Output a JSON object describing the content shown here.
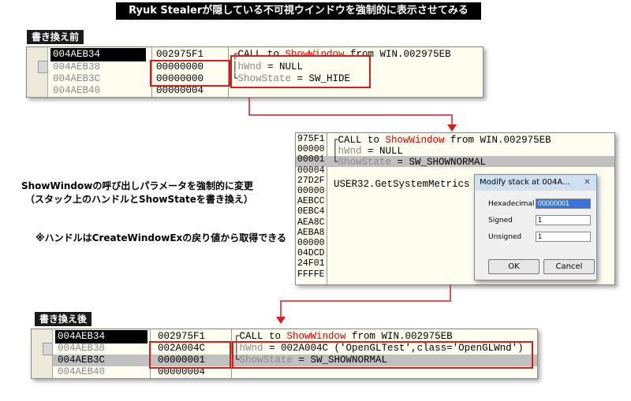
{
  "title": "Ryuk Stealerが隠している不可視ウインドウを強制的に表示させてみる",
  "before": {
    "label": "書き換え前",
    "rows": [
      {
        "addr": "004AEB34",
        "value": "002975F1",
        "comment_pre": "CALL to ",
        "comment_fn": "ShowWindow",
        "comment_post": " from WIN.002975EB"
      },
      {
        "addr": "004AEB38",
        "value": "00000000",
        "comment": "hWnd = NULL"
      },
      {
        "addr": "004AEB3C",
        "value": "00000000",
        "comment": "ShowState = SW_HIDE"
      },
      {
        "addr": "004AEB40",
        "value": "00000004",
        "comment": ""
      }
    ]
  },
  "middle": {
    "left_col": [
      "975F1",
      "00000",
      "00001",
      "00004",
      "27D2F",
      "00000",
      "AEBCC",
      "0EBC4",
      "AEA8C",
      "AEBA8",
      "00000",
      "04DCD",
      "24F01",
      "FFFFE"
    ],
    "line1_pre": "CALL to ",
    "line1_fn": "ShowWindow",
    "line1_post": " from WIN.002975EB",
    "line2": "hWnd = NULL",
    "line3": "ShowState = SW_SHOWNORMAL",
    "line5": "USER32.GetSystemMetrics"
  },
  "annotation": {
    "line1": "ShowWindowの呼び出しパラメータを強制的に変更",
    "line2": "（スタック上のハンドルとShowStateを書き換え）",
    "line3": "※ハンドルはCreateWindowExの戻り値から取得できる"
  },
  "dialog": {
    "title": "Modify stack at 004A...",
    "close": "✕",
    "fields": [
      {
        "label": "Hexadecimal",
        "value": "00000001"
      },
      {
        "label": "Signed",
        "value": "1"
      },
      {
        "label": "Unsigned",
        "value": "1"
      }
    ],
    "ok": "OK",
    "cancel": "Cancel"
  },
  "after": {
    "label": "書き換え後",
    "rows": [
      {
        "addr": "004AEB34",
        "value": "002975F1",
        "comment_pre": "CALL to ",
        "comment_fn": "ShowWindow",
        "comment_post": " from WIN.002975EB"
      },
      {
        "addr": "004AEB38",
        "value": "002A004C",
        "comment": "hWnd = 002A004C ('OpenGLTest',class='OpenGLWnd')"
      },
      {
        "addr": "004AEB3C",
        "value": "00000001",
        "comment": "ShowState = SW_SHOWNORMAL"
      },
      {
        "addr": "004AEB40",
        "value": "00000004",
        "comment": ""
      }
    ]
  },
  "colors": {
    "highlight_red": "#e00000",
    "box_red": "#d81c1c",
    "panel_bg": "#fffdf0"
  }
}
